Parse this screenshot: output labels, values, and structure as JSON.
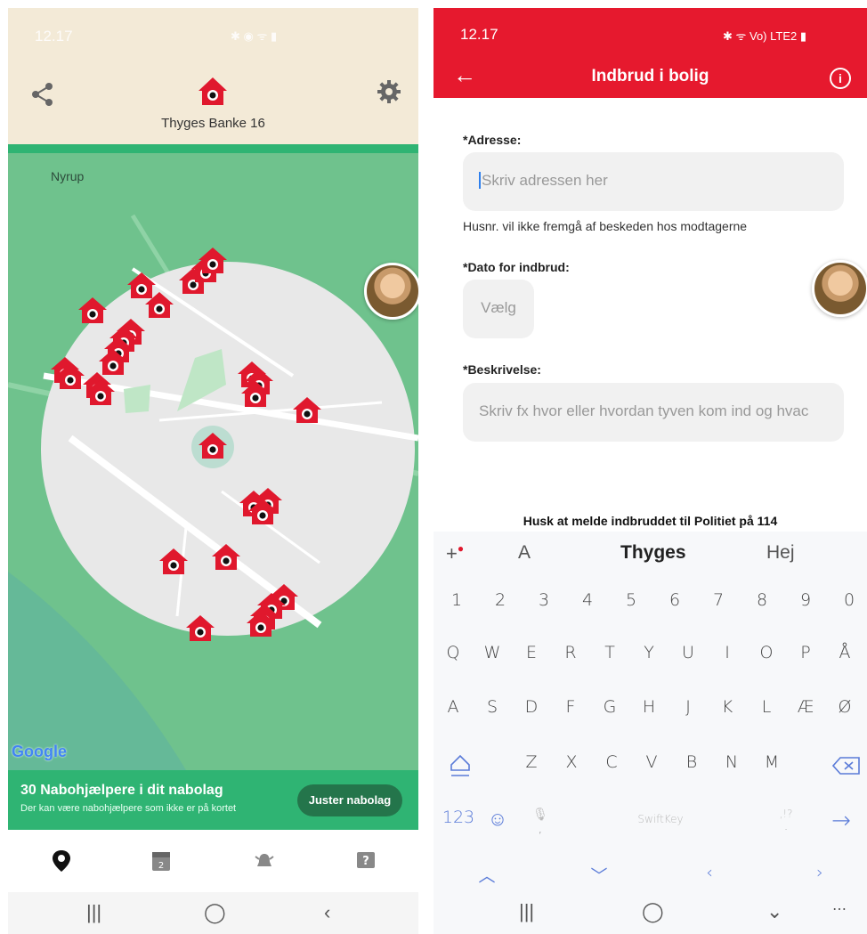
{
  "left": {
    "status": {
      "time": "12.17",
      "icons": "✱ ◉ ᯤ ▮"
    },
    "header": {
      "address": "Thyges Banke 16",
      "share_icon": "share-icon",
      "home_icon": "home-pin-icon",
      "settings_icon": "gear-icon"
    },
    "map": {
      "place_label": "Nyrup",
      "attribution": "Google",
      "colors": {
        "land": "#6fc28d",
        "circle": "#e8e8e8",
        "marker": "#e0182d"
      }
    },
    "banner": {
      "count_text": "30 Nabohjælpere i dit nabolag",
      "note": "Der kan være nabohjælpere som ikke er på kortet",
      "button_label": "Juster nabolag"
    },
    "tabs": [
      "map-pin-icon",
      "calendar-icon",
      "alarm-icon",
      "help-icon"
    ],
    "nav": [
      "|||",
      "◯",
      "‹"
    ]
  },
  "right": {
    "status": {
      "time": "12.17",
      "icons": "✱ ᯤ Vo) LTE2 ▮"
    },
    "header": {
      "back": "←",
      "title": "Indbrud i bolig",
      "info": "i"
    },
    "form": {
      "address_label": "*Adresse:",
      "address_placeholder": "Skriv adressen her",
      "address_hint": "Husnr. vil ikke fremgå af beskeden hos modtagerne",
      "date_label": "*Dato for indbrud:",
      "date_button": "Vælg",
      "desc_label": "*Beskrivelse:",
      "desc_placeholder": "Skriv fx hvor eller hvordan tyven kom ind og hvac",
      "police_note": "Husk at melde indbruddet til Politiet på 114"
    },
    "keyboard": {
      "suggestions": [
        "A",
        "Thyges",
        "Hej"
      ],
      "row_numbers": [
        "1",
        "2",
        "3",
        "4",
        "5",
        "6",
        "7",
        "8",
        "9",
        "0"
      ],
      "row_1": [
        "Q",
        "W",
        "E",
        "R",
        "T",
        "Y",
        "U",
        "I",
        "O",
        "P",
        "Å"
      ],
      "row_2": [
        "A",
        "S",
        "D",
        "F",
        "G",
        "H",
        "J",
        "K",
        "L",
        "Æ",
        "Ø"
      ],
      "row_3": [
        "Z",
        "X",
        "C",
        "V",
        "B",
        "N",
        "M"
      ],
      "numbers_key": "123",
      "brand": "SwiftKey",
      "comma": ",",
      "period": "."
    },
    "nav": [
      "|||",
      "◯",
      "⌄",
      "⋯"
    ]
  }
}
